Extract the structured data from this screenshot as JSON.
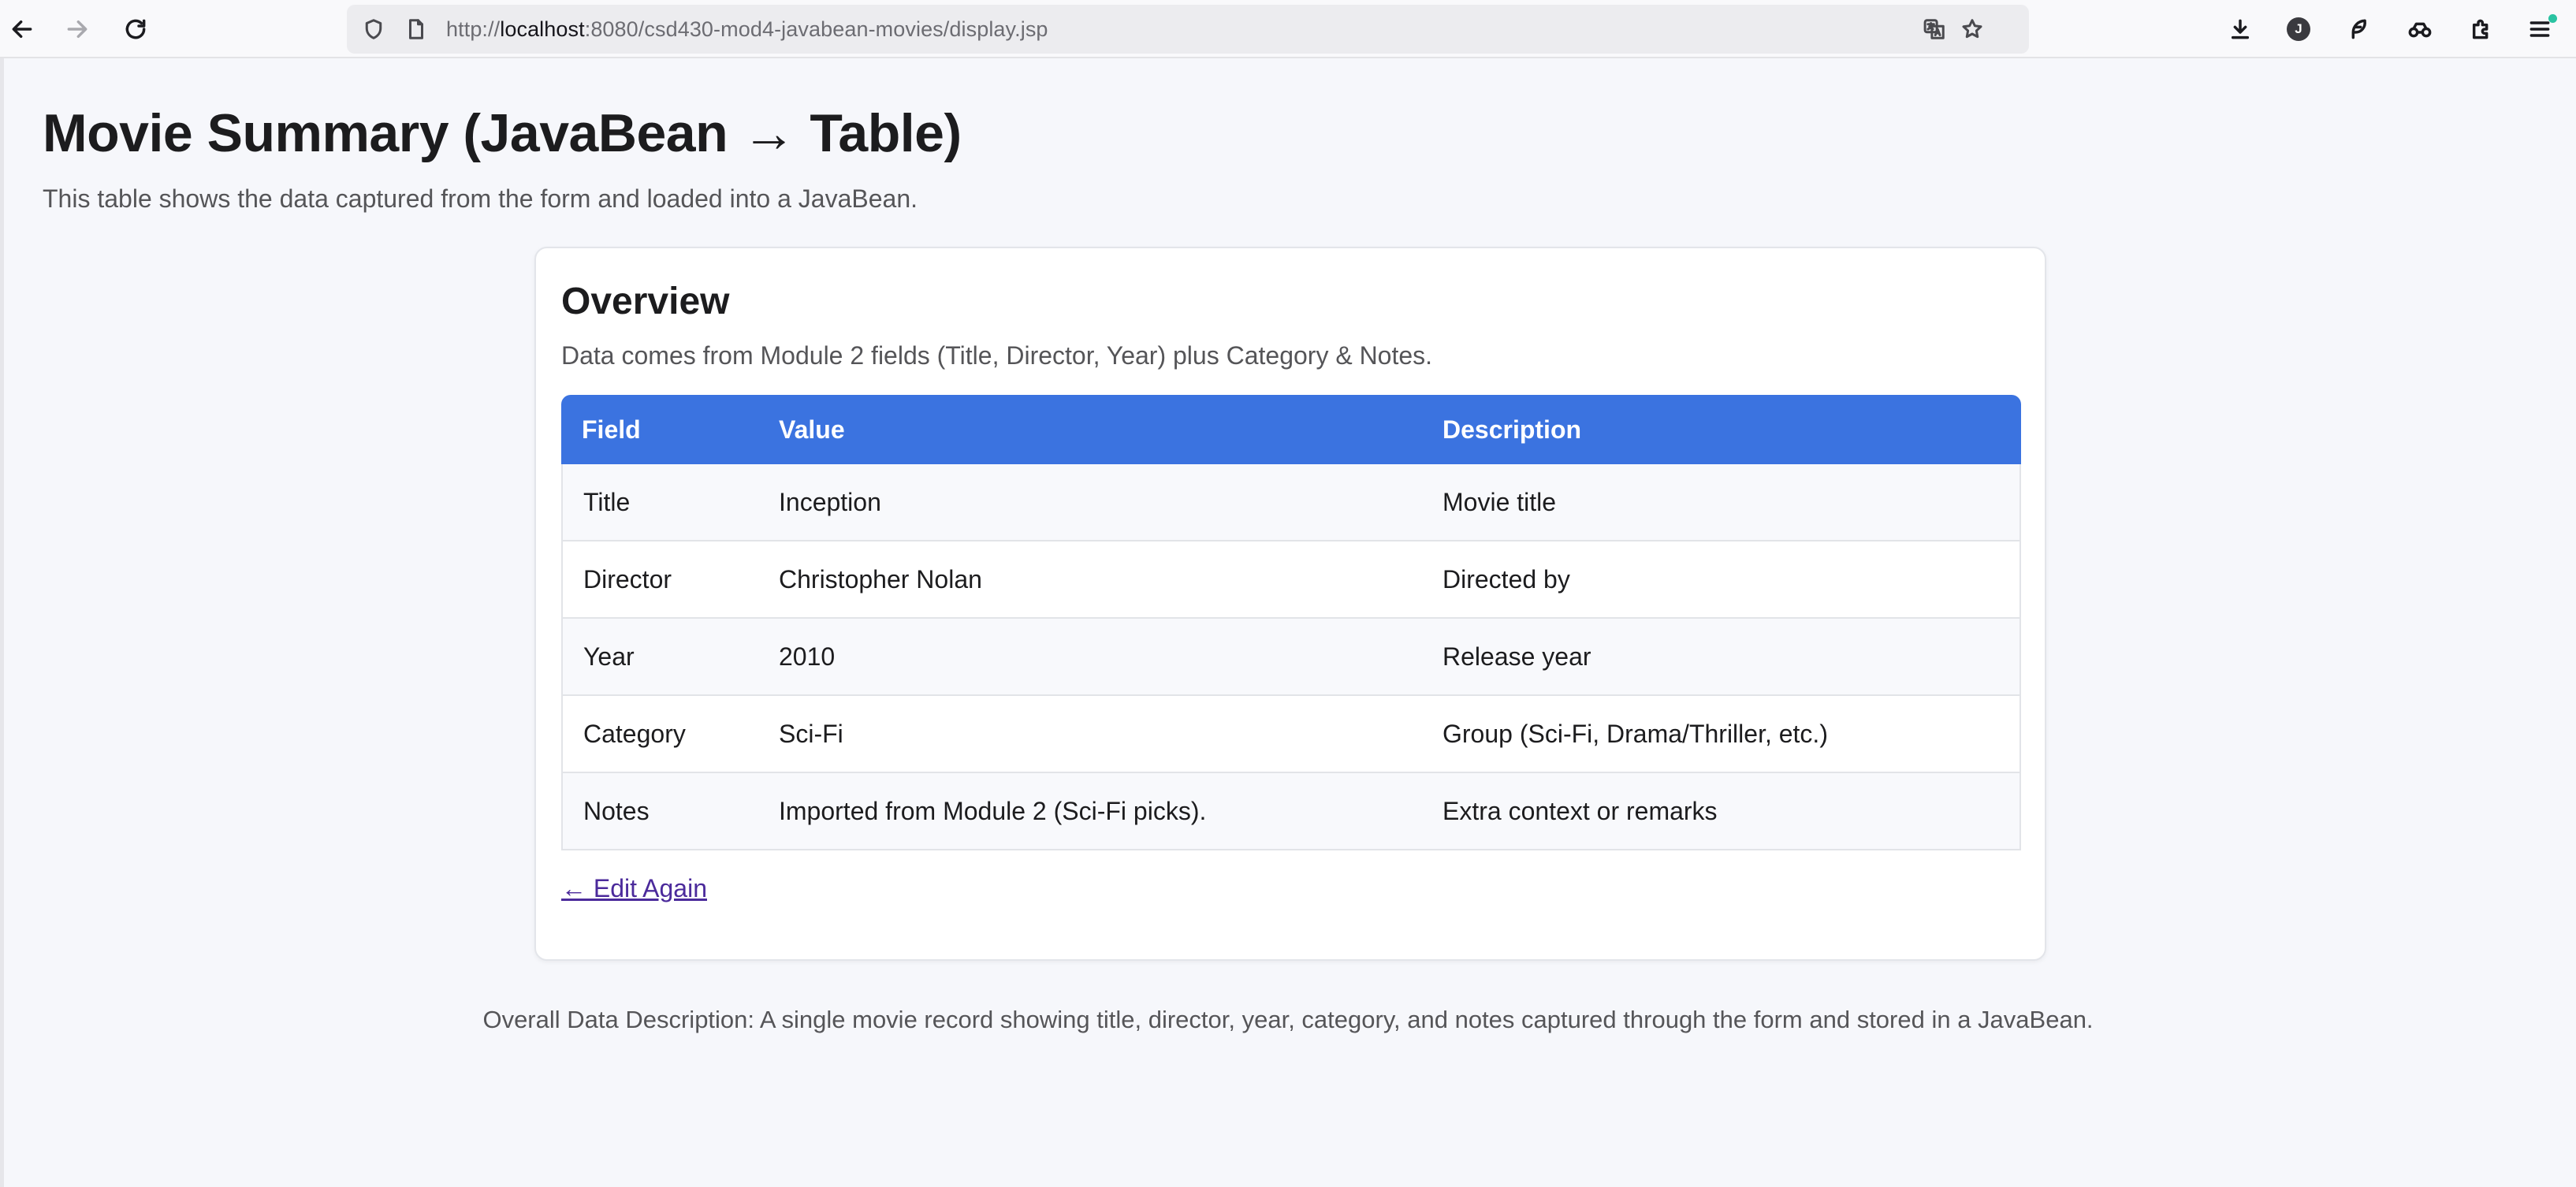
{
  "browser": {
    "url_scheme": "http://",
    "url_host": "localhost",
    "url_rest": ":8080/csd430-mod4-javabean-movies/display.jsp",
    "account_initial": "J"
  },
  "page": {
    "title": "Movie Summary (JavaBean → Table)",
    "subtitle": "This table shows the data captured from the form and loaded into a JavaBean."
  },
  "card": {
    "title": "Overview",
    "description": "Data comes from Module 2 fields (Title, Director, Year) plus Category & Notes.",
    "table": {
      "headers": [
        "Field",
        "Value",
        "Description"
      ],
      "rows": [
        [
          "Title",
          "Inception",
          "Movie title"
        ],
        [
          "Director",
          "Christopher Nolan",
          "Directed by"
        ],
        [
          "Year",
          "2010",
          "Release year"
        ],
        [
          "Category",
          "Sci-Fi",
          "Group (Sci-Fi, Drama/Thriller, etc.)"
        ],
        [
          "Notes",
          "Imported from Module 2 (Sci-Fi picks).",
          "Extra context or remarks"
        ]
      ]
    },
    "edit_link": "← Edit Again"
  },
  "footer": {
    "description": "Overall Data Description: A single movie record showing title, director, year, category, and notes captured through the form and stored in a JavaBean."
  },
  "colors": {
    "header_accent": "#3b73e0",
    "link": "#4b2a9b",
    "page_background": "#f6f7fb"
  },
  "icons": [
    "back-icon",
    "forward-icon",
    "reload-icon",
    "shield-icon",
    "page-icon",
    "translate-icon",
    "bookmark-star-icon",
    "download-icon",
    "account-icon",
    "extension-feather-icon",
    "tracking-icon",
    "extensions-puzzle-icon",
    "menu-icon"
  ]
}
